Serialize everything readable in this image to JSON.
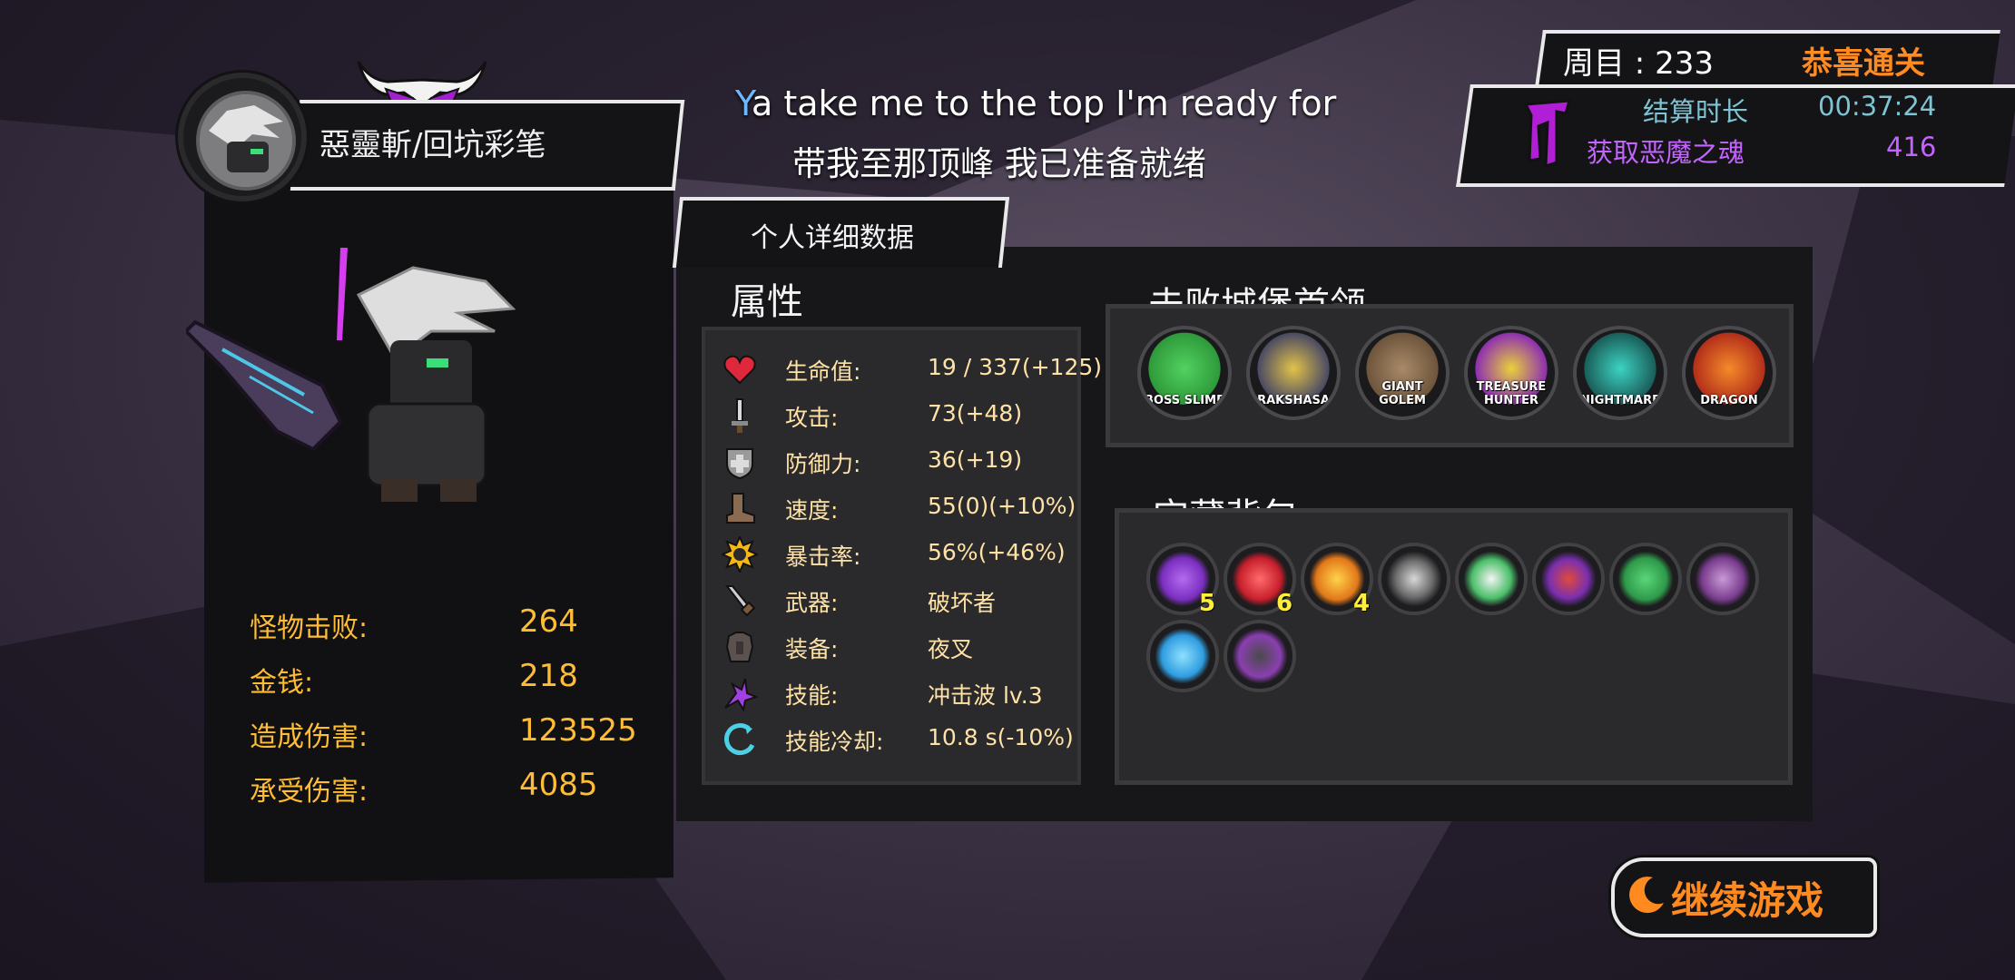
{
  "player": {
    "name": "惡靈斬/回坑彩笔",
    "stats": [
      {
        "label": "怪物击败:",
        "value": "264"
      },
      {
        "label": "金钱:",
        "value": "218"
      },
      {
        "label": "造成伤害:",
        "value": "123525"
      },
      {
        "label": "承受伤害:",
        "value": "4085"
      }
    ]
  },
  "lyrics": {
    "line1_first": "Y",
    "line1_rest": "a take me to the top I'm ready for",
    "line2": "带我至那顶峰 我已准备就绪"
  },
  "tab": {
    "label": "个人详细数据"
  },
  "attributes": {
    "title": "属性",
    "rows": [
      {
        "icon": "heart-icon",
        "label": "生命值:",
        "value": "19 / 337(+125)"
      },
      {
        "icon": "sword-icon",
        "label": "攻击:",
        "value": "73(+48)"
      },
      {
        "icon": "shield-icon",
        "label": "防御力:",
        "value": "36(+19)"
      },
      {
        "icon": "boot-icon",
        "label": "速度:",
        "value": "55(0)(+10%)"
      },
      {
        "icon": "sun-icon",
        "label": "暴击率:",
        "value": "56%(+46%)"
      },
      {
        "icon": "weapon-icon",
        "label": "武器:",
        "value": "破坏者"
      },
      {
        "icon": "armor-icon",
        "label": "装备:",
        "value": "夜叉"
      },
      {
        "icon": "skill-icon",
        "label": "技能:",
        "value": "冲击波 lv.3"
      },
      {
        "icon": "cooldown-icon",
        "label": "技能冷却:",
        "value": "10.8 s(-10%)"
      }
    ]
  },
  "bosses": {
    "title": "击败城堡首领",
    "list": [
      {
        "name": "BOSS SLIME",
        "color": "#3bb54a"
      },
      {
        "name": "RAKSHASA",
        "color": "#c9a227"
      },
      {
        "name": "GIANT GOLEM",
        "color": "#8a6b4a"
      },
      {
        "name": "TREASURE HUNTER",
        "color": "#b03fc4"
      },
      {
        "name": "NIGHTMARE",
        "color": "#1f8f8a"
      },
      {
        "name": "DRAGON",
        "color": "#d6461f"
      }
    ]
  },
  "bag": {
    "title": "宝藏背包",
    "items": [
      {
        "icon": "purple-crystal-icon",
        "color": "#8e3fd6",
        "count": "5"
      },
      {
        "icon": "red-crystal-icon",
        "color": "#d62f3a",
        "count": "6"
      },
      {
        "icon": "orange-crystal-icon",
        "color": "#f0a21f",
        "count": "4"
      },
      {
        "icon": "bone-cross-icon",
        "color": "#8c8c8c",
        "count": ""
      },
      {
        "icon": "egg-icon",
        "color": "#4bbf6a",
        "count": ""
      },
      {
        "icon": "demon-eye-icon",
        "color": "#7b2fb0",
        "count": ""
      },
      {
        "icon": "clover-icon",
        "color": "#2e9a4a",
        "count": ""
      },
      {
        "icon": "purple-orb-icon",
        "color": "#7a3c8e",
        "count": ""
      },
      {
        "icon": "blue-crystal-icon",
        "color": "#2f9de0",
        "count": ""
      },
      {
        "icon": "dark-stone-icon",
        "color": "#8a3fb0",
        "count": ""
      }
    ]
  },
  "loop": {
    "label": "周目 : 233",
    "status": "恭喜通关"
  },
  "results": {
    "time_label": "结算时长",
    "time_value": "00:37:24",
    "souls_label": "获取恶魔之魂",
    "souls_value": "416"
  },
  "continue_button": {
    "label": "继续游戏"
  },
  "colors": {
    "accent": "#ff8a1f",
    "stat_gold": "#ffbd35",
    "soul_purple": "#c464ff",
    "time_cyan": "#7ec4d3"
  }
}
